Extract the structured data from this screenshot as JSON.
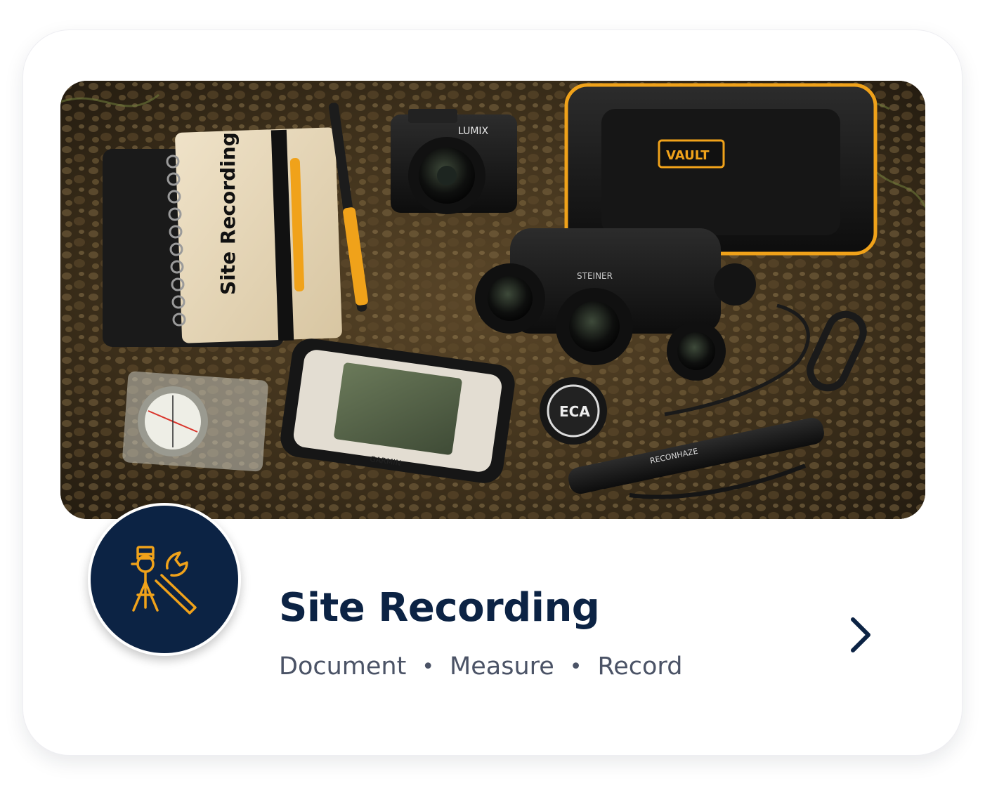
{
  "card": {
    "title": "Site Recording",
    "tags": [
      "Document",
      "Measure",
      "Record"
    ],
    "separator": "•",
    "hero_alt": "Flat lay of field equipment: spiral notebook, pen, camera, rugged case, binoculars, compass, GPS unit, lens cap, flashlight and carabiner on gravel"
  },
  "hero_labels": {
    "notebook": "Site Recording",
    "camera": "LUMIX",
    "case": "VAULT",
    "binoculars": "STEINER",
    "gps": "GARMIN",
    "lens_cap": "ECA",
    "flashlight": "RECONHAZE"
  },
  "icons": {
    "badge": "survey-tools-icon",
    "chevron": "chevron-right-icon"
  },
  "colors": {
    "navy": "#0c2344",
    "accent_orange": "#f0a21a",
    "subtitle_gray": "#4b5366"
  }
}
